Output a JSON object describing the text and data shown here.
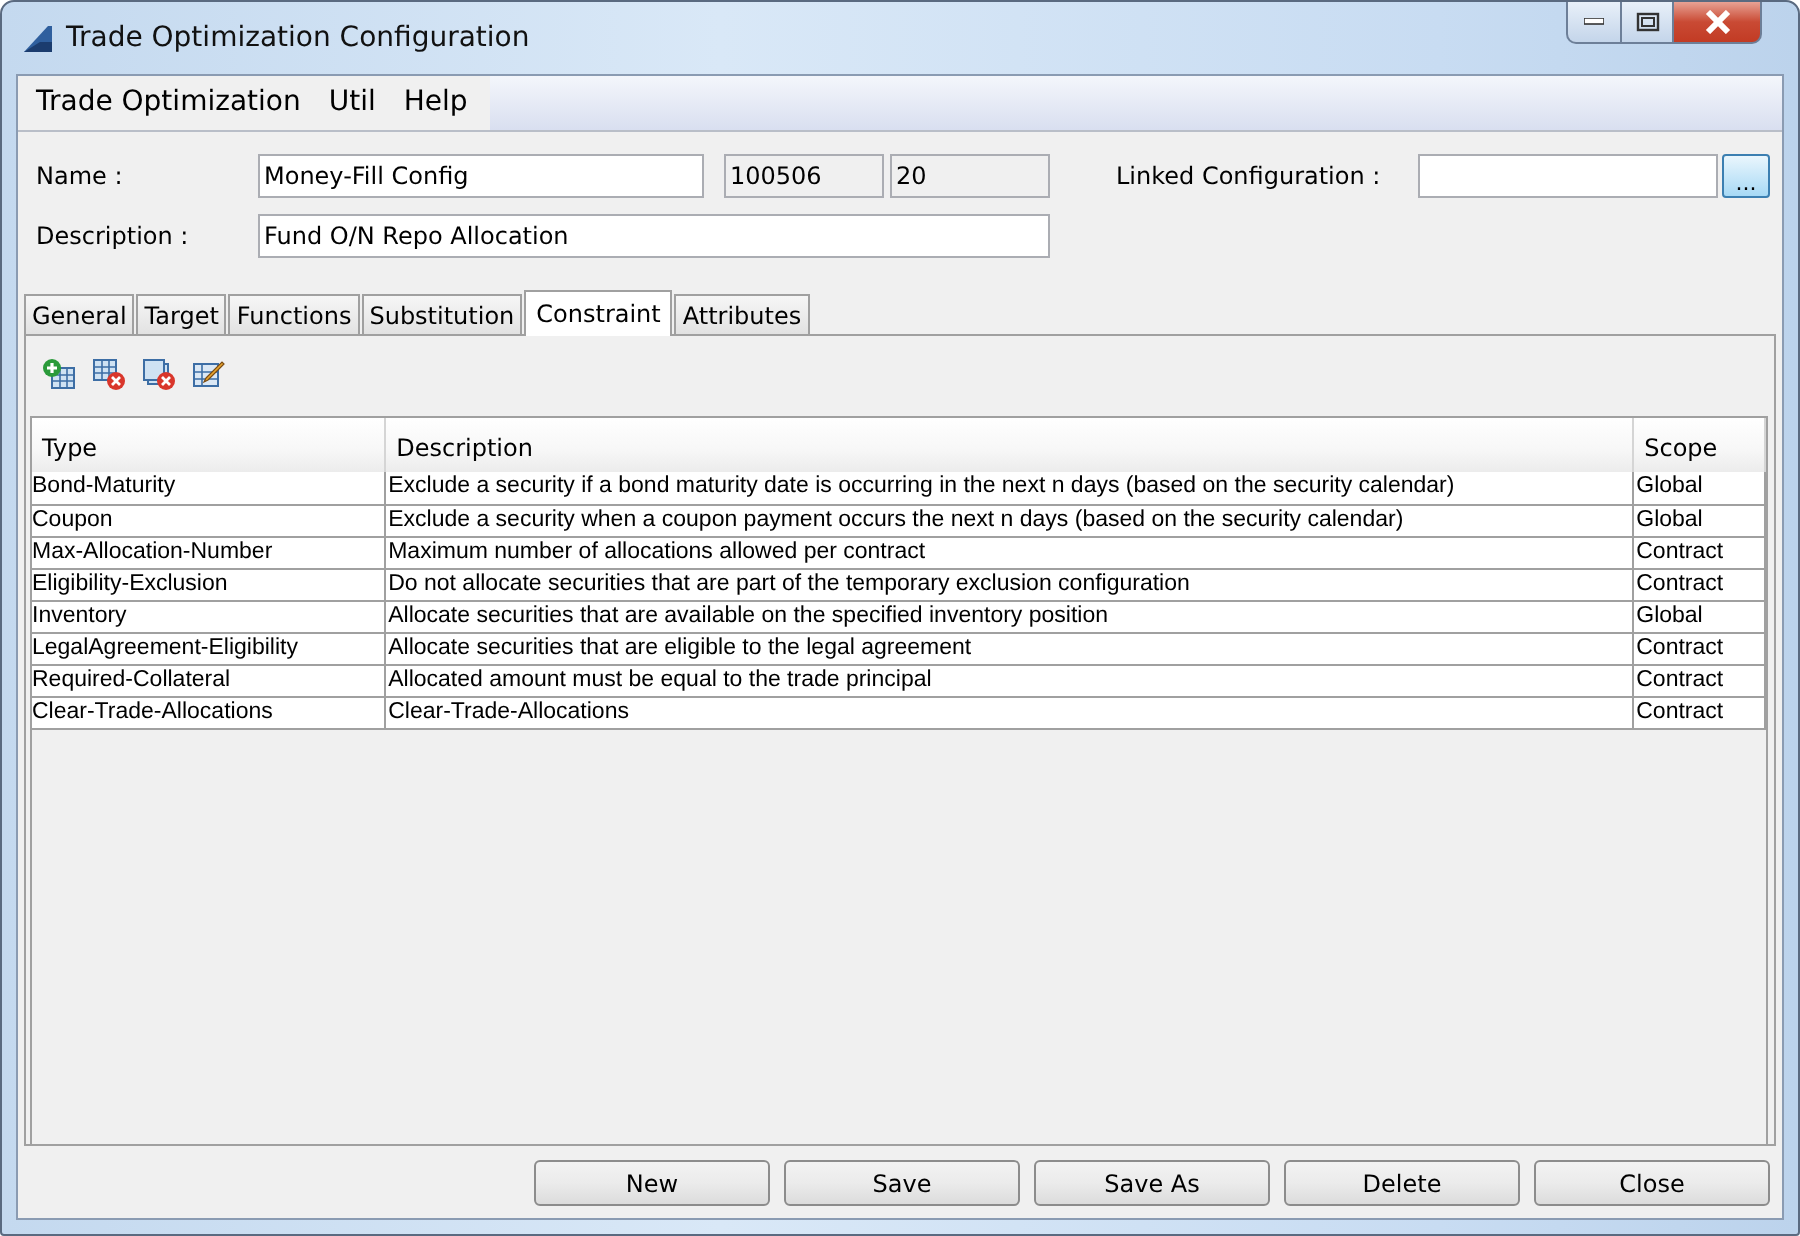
{
  "window": {
    "title": "Trade Optimization Configuration"
  },
  "menu": [
    "Trade Optimization",
    "Util",
    "Help"
  ],
  "form": {
    "name_label": "Name :",
    "name": "Money-Fill Config",
    "field_2": "100506",
    "field_3": "20",
    "linked_label": "Linked Configuration :",
    "browse_button": "...",
    "description_label": "Description :",
    "description": "Fund O/N Repo Allocation"
  },
  "tabs": [
    {
      "label": "General",
      "selected": false
    },
    {
      "label": "Target",
      "selected": false
    },
    {
      "label": "Functions",
      "selected": false
    },
    {
      "label": "Substitution",
      "selected": false
    },
    {
      "label": "Constraint",
      "selected": true
    },
    {
      "label": "Attributes",
      "selected": false
    }
  ],
  "table": {
    "columns": [
      "Type",
      "Description",
      "Scope"
    ],
    "rows": [
      [
        "Bond-Maturity",
        "Exclude a security if a bond maturity date is occurring in the next n days (based on the security calendar)",
        "Global"
      ],
      [
        "Coupon",
        "Exclude a security when a coupon payment occurs the next n days (based on the security calendar)",
        "Global"
      ],
      [
        "Max-Allocation-Number",
        "Maximum number of allocations allowed per contract",
        "Contract"
      ],
      [
        "Eligibility-Exclusion",
        "Do not allocate securities that are part of the temporary exclusion configuration",
        "Contract"
      ],
      [
        "Inventory",
        "Allocate securities that are available on the specified inventory position",
        "Global"
      ],
      [
        "LegalAgreement-Eligibility",
        "Allocate securities that are eligible to the legal agreement",
        "Contract"
      ],
      [
        "Required-Collateral",
        "Allocated amount must be equal to the trade principal",
        "Contract"
      ],
      [
        "Clear-Trade-Allocations",
        "Clear-Trade-Allocations",
        "Contract"
      ]
    ]
  },
  "buttons": [
    "New",
    "Save",
    "Save As",
    "Delete",
    "Close"
  ]
}
